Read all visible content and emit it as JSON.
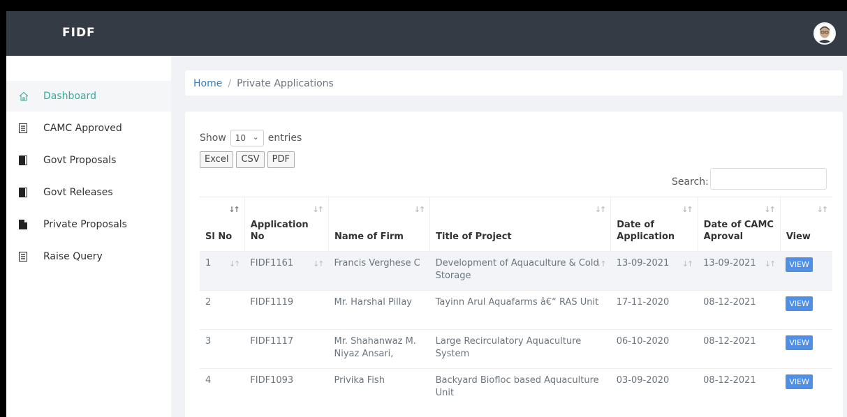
{
  "header": {
    "brand": "FIDF"
  },
  "sidebar": {
    "items": [
      {
        "label": "Dashboard",
        "icon": "home-icon",
        "active": true
      },
      {
        "label": "CAMC Approved",
        "icon": "list-icon"
      },
      {
        "label": "Govt Proposals",
        "icon": "book-icon"
      },
      {
        "label": "Govt Releases",
        "icon": "book-icon"
      },
      {
        "label": "Private Proposals",
        "icon": "file-icon"
      },
      {
        "label": "Raise Query",
        "icon": "list-icon"
      }
    ]
  },
  "breadcrumb": {
    "home": "Home",
    "separator": "/",
    "current": "Private Applications"
  },
  "controls": {
    "show_label": "Show",
    "entries_value": "10",
    "entries_label": "entries",
    "export_buttons": [
      "Excel",
      "CSV",
      "PDF"
    ],
    "search_label": "Search:"
  },
  "table": {
    "columns": [
      "Sl No",
      "Application No",
      "Name of Firm",
      "Title of Project",
      "Date of Application",
      "Date of CAMC Aproval",
      "View"
    ],
    "rows": [
      {
        "sl": "1",
        "app_no": "FIDF1161",
        "firm": "Francis Verghese C",
        "title": "Development of Aquaculture & Cold Storage",
        "date_app": "13-09-2021",
        "date_camc": "13-09-2021",
        "view": "VIEW"
      },
      {
        "sl": "2",
        "app_no": "FIDF1119",
        "firm": "Mr. Harshal Pillay",
        "title": "Tayinn Arul Aquafarms â€“ RAS Unit",
        "date_app": "17-11-2020",
        "date_camc": "08-12-2021",
        "view": "VIEW"
      },
      {
        "sl": "3",
        "app_no": "FIDF1117",
        "firm": "Mr. Shahanwaz M. Niyaz Ansari,",
        "title": "Large Recirculatory Aquaculture System",
        "date_app": "06-10-2020",
        "date_camc": "08-12-2021",
        "view": "VIEW"
      },
      {
        "sl": "4",
        "app_no": "FIDF1093",
        "firm": "Privika Fish",
        "title": "Backyard Biofloc based Aquaculture Unit",
        "date_app": "03-09-2020",
        "date_camc": "08-12-2021",
        "view": "VIEW"
      }
    ]
  },
  "colors": {
    "topbar": "#343b44",
    "accent": "#3aa89a",
    "view_button": "#4f8fe6"
  }
}
